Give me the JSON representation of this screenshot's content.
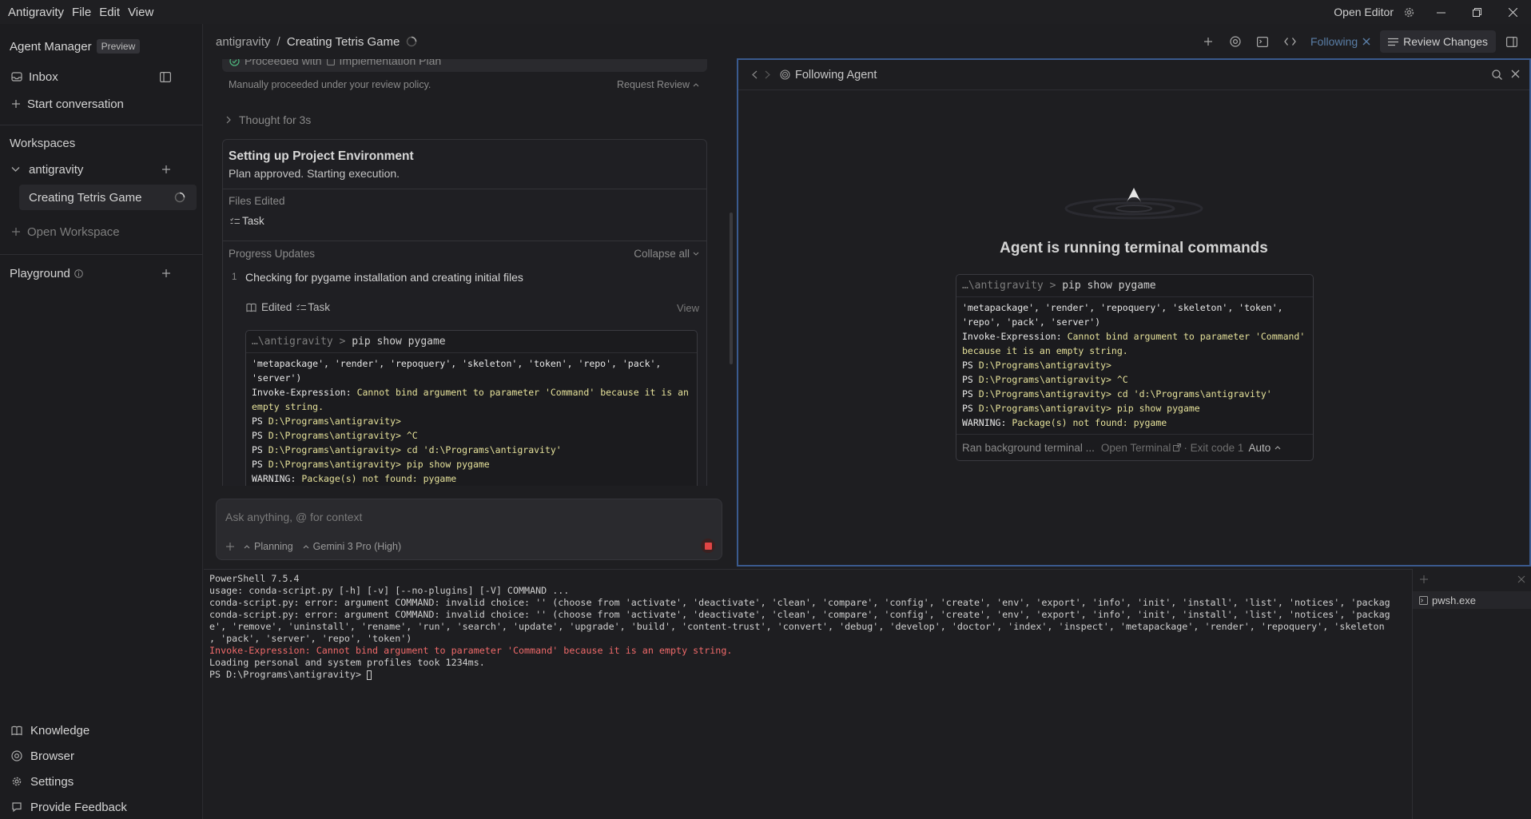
{
  "titlebar": {
    "app_name": "Antigravity",
    "menu": [
      "File",
      "Edit",
      "View"
    ],
    "open_editor": "Open Editor"
  },
  "sidebar": {
    "agent_manager": "Agent Manager",
    "preview_badge": "Preview",
    "inbox": "Inbox",
    "start_conversation": "Start conversation",
    "workspaces_heading": "Workspaces",
    "workspace_name": "antigravity",
    "workspace_item": "Creating Tetris Game",
    "open_workspace": "Open Workspace",
    "playground": "Playground",
    "bottom": {
      "knowledge": "Knowledge",
      "browser": "Browser",
      "settings": "Settings",
      "feedback": "Provide Feedback"
    }
  },
  "topbar": {
    "crumb_workspace": "antigravity",
    "crumb_sep": "/",
    "crumb_title": "Creating Tetris Game",
    "following": "Following",
    "review_changes": "Review Changes"
  },
  "chat": {
    "proceeded_text": "Proceeded with",
    "impl_plan": "Implementation Plan",
    "policy_note": "Manually proceeded under your review policy.",
    "request_review": "Request Review",
    "thought": "Thought for 3s",
    "task_title": "Setting up Project Environment",
    "task_subtitle": "Plan approved. Starting execution.",
    "files_edited": "Files Edited",
    "file_task": "Task",
    "progress_updates": "Progress Updates",
    "collapse_all": "Collapse all",
    "step_num": "1",
    "step_text": "Checking for pygame installation and creating initial files",
    "edited": "Edited",
    "edited_task": "Task",
    "view": "View",
    "term_path": "…\\antigravity",
    "term_cmd": "pip show pygame",
    "term_lines": [
      {
        "cls": "wht",
        "t": "'metapackage', 'render', 'repoquery', 'skeleton', 'token', 'repo', 'pack',"
      },
      {
        "cls": "wht",
        "t": "'server')"
      },
      {
        "cls": "mixed1",
        "a": "Invoke-Expression: ",
        "b": "Cannot bind argument to parameter 'Command' because it is an"
      },
      {
        "cls": "grn",
        "t": "empty string."
      },
      {
        "cls": "ps",
        "a": "PS ",
        "b": "D:\\Programs\\antigravity>"
      },
      {
        "cls": "ps",
        "a": "PS ",
        "b": "D:\\Programs\\antigravity> ^C"
      },
      {
        "cls": "ps",
        "a": "PS ",
        "b": "D:\\Programs\\antigravity> cd 'd:\\Programs\\antigravity'"
      },
      {
        "cls": "ps",
        "a": "PS ",
        "b": "D:\\Programs\\antigravity> pip show pygame"
      },
      {
        "cls": "warn",
        "a": "WARNING: ",
        "b": "Package(s) not found: pygame"
      }
    ],
    "input_placeholder": "Ask anything, @ for context",
    "mode": "Planning",
    "model": "Gemini 3 Pro (High)"
  },
  "agent_panel": {
    "title": "Following Agent",
    "heading": "Agent is running terminal commands",
    "term_path": "…\\antigravity",
    "term_cmd": "pip show pygame",
    "lines": [
      {
        "cls": "wht",
        "t": "'metapackage', 'render', 'repoquery', 'skeleton', 'token',"
      },
      {
        "cls": "wht",
        "t": "'repo', 'pack', 'server')"
      },
      {
        "cls": "mixed1",
        "a": "Invoke-Expression: ",
        "b": "Cannot bind argument to parameter 'Command'"
      },
      {
        "cls": "grn",
        "t": "because it is an empty string."
      },
      {
        "cls": "ps",
        "a": "PS ",
        "b": "D:\\Programs\\antigravity>"
      },
      {
        "cls": "ps",
        "a": "PS ",
        "b": "D:\\Programs\\antigravity> ^C"
      },
      {
        "cls": "ps",
        "a": "PS ",
        "b": "D:\\Programs\\antigravity> cd 'd:\\Programs\\antigravity'"
      },
      {
        "cls": "ps",
        "a": "PS ",
        "b": "D:\\Programs\\antigravity> pip show pygame"
      },
      {
        "cls": "warn",
        "a": "WARNING: ",
        "b": "Package(s) not found: pygame"
      }
    ],
    "footer_ran": "Ran background terminal ...",
    "footer_open": "Open Terminal",
    "footer_exit": "· Exit code 1",
    "footer_auto": "Auto"
  },
  "terminal": {
    "lines": [
      {
        "cls": "",
        "t": "PowerShell 7.5.4"
      },
      {
        "cls": "",
        "t": "usage: conda-script.py [-h] [-v] [--no-plugins] [-V] COMMAND ..."
      },
      {
        "cls": "",
        "t": "conda-script.py: error: argument COMMAND: invalid choice: '' (choose from 'activate', 'deactivate', 'clean', 'compare', 'config', 'create', 'env', 'export', 'info', 'init', 'install', 'list', 'notices', 'packag"
      },
      {
        "cls": "",
        "t": "conda-script.py: error: argument COMMAND: invalid choice: '' (choose from 'activate', 'deactivate', 'clean', 'compare', 'config', 'create', 'env', 'export', 'info', 'init', 'install', 'list', 'notices', 'packag"
      },
      {
        "cls": "",
        "t": "e', 'remove', 'uninstall', 'rename', 'run', 'search', 'update', 'upgrade', 'build', 'content-trust', 'convert', 'debug', 'develop', 'doctor', 'index', 'inspect', 'metapackage', 'render', 'repoquery', 'skeleton"
      },
      {
        "cls": "",
        "t": ", 'pack', 'server', 'repo', 'token')"
      },
      {
        "cls": "err",
        "t": "Invoke-Expression: Cannot bind argument to parameter 'Command' because it is an empty string."
      },
      {
        "cls": "",
        "t": "Loading personal and system profiles took 1234ms."
      },
      {
        "cls": "",
        "t": "PS D:\\Programs\\antigravity> "
      }
    ],
    "process": "pwsh.exe"
  }
}
